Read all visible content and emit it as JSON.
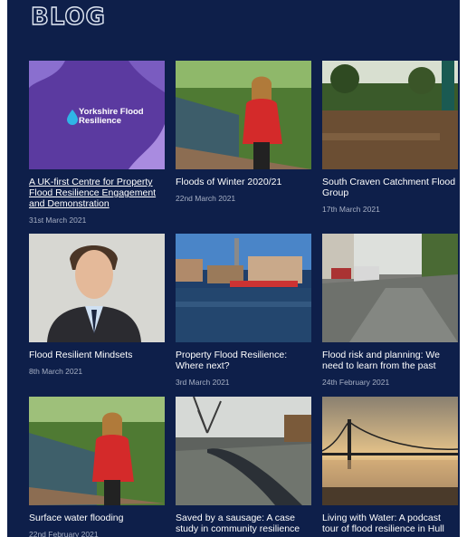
{
  "header": {
    "title": "BLOG"
  },
  "posts": [
    {
      "title": "A UK-first Centre for Property Flood Resilience Engagement and Demonstration",
      "date": "31st March 2021",
      "image": "yorkshire-flood-resilience-logo",
      "logo_text": "Yorkshire Flood Resilience"
    },
    {
      "title": "Floods of Winter 2020/21",
      "date": "22nd March 2021",
      "image": "woman-red-coat-by-river"
    },
    {
      "title": "South Craven Catchment Flood Group",
      "date": "17th March 2021",
      "image": "flooded-park"
    },
    {
      "title": "Flood Resilient Mindsets",
      "date": "8th March 2021",
      "image": "man-in-suit-portrait"
    },
    {
      "title": "Property Flood Resilience: Where next?",
      "date": "3rd March 2021",
      "image": "river-bridge-town"
    },
    {
      "title": "Flood risk and planning: We need to learn from the past",
      "date": "24th February 2021",
      "image": "flooded-street-cars"
    },
    {
      "title": "Surface water flooding",
      "date": "22nd February 2021",
      "image": "woman-red-coat-by-river"
    },
    {
      "title": "Saved by a sausage: A case study in community resilience",
      "date": "",
      "image": "flood-barrier-tube"
    },
    {
      "title": "Living with Water: A podcast tour of flood resilience in Hull",
      "date": "",
      "image": "humber-bridge-sunset"
    }
  ],
  "colors": {
    "background": "#0e1f4a",
    "title_text": "#ffffff",
    "date_text": "#a7b0c5",
    "logo_purple": "#5b3aa0"
  }
}
